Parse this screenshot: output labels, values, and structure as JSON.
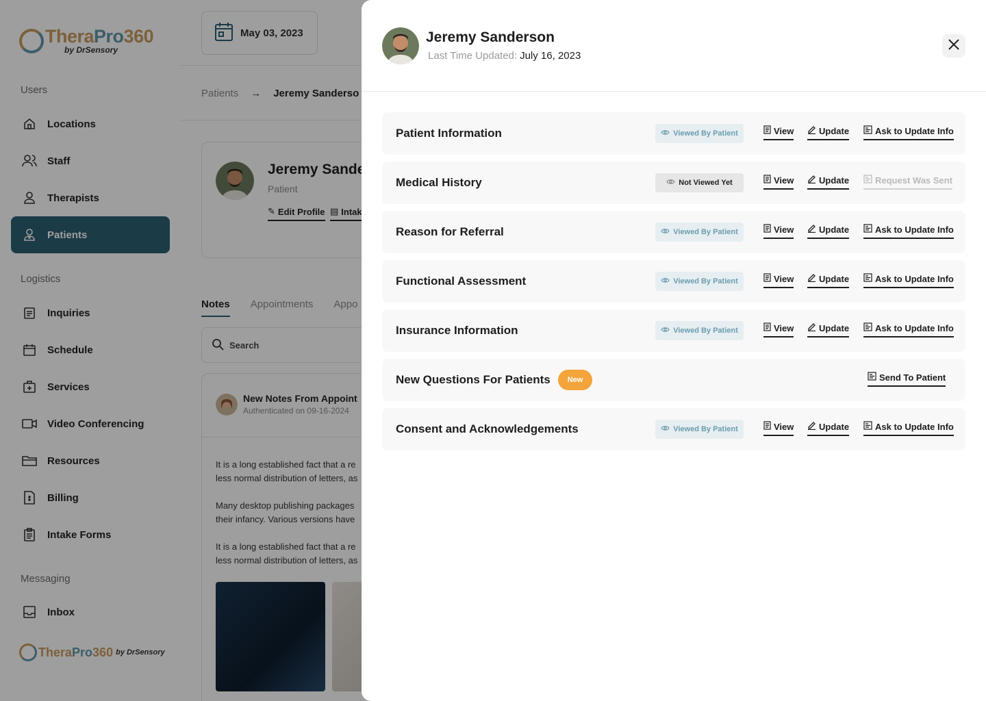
{
  "app": {
    "logo": {
      "part1": "Thera",
      "part2": "Pro",
      "part3": "360",
      "byline": "by DrSensory"
    },
    "sidebar": {
      "sections": [
        {
          "label": "Users",
          "items": [
            "Locations",
            "Staff",
            "Therapists",
            "Patients"
          ]
        },
        {
          "label": "Logistics",
          "items": [
            "Inquiries",
            "Schedule",
            "Services",
            "Video Conferencing",
            "Resources",
            "Billing",
            "Intake Forms"
          ]
        },
        {
          "label": "Messaging",
          "items": [
            "Inbox"
          ]
        }
      ],
      "active_item": "Patients"
    },
    "date": "May 03, 2023",
    "breadcrumb": {
      "parent": "Patients",
      "current": "Jeremy Sanderso"
    },
    "profile": {
      "name": "Jeremy Sande",
      "role": "Patient",
      "edit_label": "Edit Profile",
      "intake_label": "Intak"
    },
    "tabs": [
      "Notes",
      "Appointments",
      "Appo"
    ],
    "search_placeholder": "Search",
    "note": {
      "title": "New Notes From Appoint",
      "date": "Authenticated on 09-16-2024",
      "p1a": "It is a long established fact that a re",
      "p1b": "less normal distribution of letters, as",
      "p2a": "Many desktop publishing packages",
      "p2b": "their infancy. Various versions have",
      "p3a": "It is a long established fact that a re",
      "p3b": "less normal distribution of letters, as"
    }
  },
  "modal": {
    "patient_name": "Jeremy Sanderson",
    "last_updated_label": "Last Time Updated:",
    "last_updated_value": "July 16, 2023",
    "actions": {
      "view": "View",
      "update": "Update",
      "ask": "Ask to Update Info",
      "request_sent": "Request Was Sent",
      "send": "Send To Patient"
    },
    "badges": {
      "viewed": "Viewed By Patient",
      "not_viewed": "Not Viewed Yet",
      "new": "New"
    },
    "rows": [
      {
        "title": "Patient Information",
        "status": "viewed"
      },
      {
        "title": "Medical History",
        "status": "not_viewed"
      },
      {
        "title": "Reason for Referral",
        "status": "viewed"
      },
      {
        "title": "Functional Assessment",
        "status": "viewed"
      },
      {
        "title": "Insurance Information",
        "status": "viewed"
      },
      {
        "title": "New Questions For Patients",
        "status": "new"
      },
      {
        "title": "Consent and Acknowledgements",
        "status": "viewed"
      }
    ]
  },
  "colors": {
    "accent": "#2d5f73",
    "badge_viewed_bg": "#e6eef1",
    "new_pill": "#f3a43a"
  }
}
